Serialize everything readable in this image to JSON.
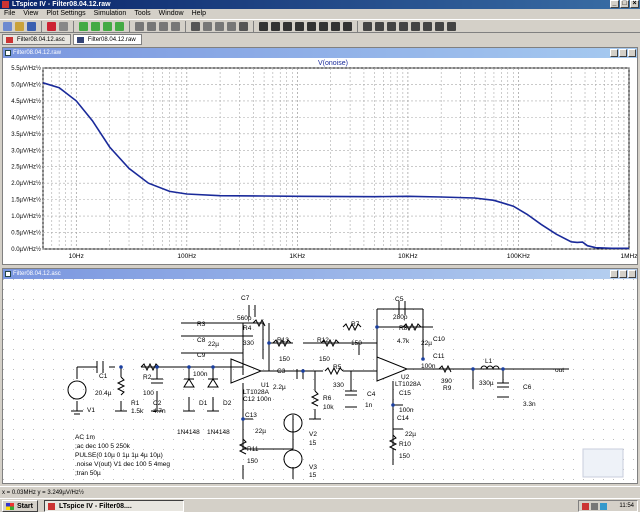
{
  "window": {
    "title": "LTspice IV - Filter08.04.12.raw"
  },
  "menu": [
    "File",
    "View",
    "Plot Settings",
    "Simulation",
    "Tools",
    "Window",
    "Help"
  ],
  "tabs": [
    {
      "label": "Filter08.04.12.asc",
      "active": false
    },
    {
      "label": "Filter08.04.12.raw",
      "active": true
    }
  ],
  "plot": {
    "window_title": "Filter08.04.12.raw",
    "trace_label": "V(onoise)",
    "trace_color": "#1a2a9a"
  },
  "chart_data": {
    "type": "line",
    "xscale": "log",
    "xlim": [
      5,
      1000000
    ],
    "ylim": [
      0,
      5.5
    ],
    "grid": true,
    "y_tick_labels": [
      "0.0µV/Hz½",
      "0.5µV/Hz½",
      "1.0µV/Hz½",
      "1.5µV/Hz½",
      "2.0µV/Hz½",
      "2.5µV/Hz½",
      "3.0µV/Hz½",
      "3.5µV/Hz½",
      "4.0µV/Hz½",
      "4.5µV/Hz½",
      "5.0µV/Hz½",
      "5.5µV/Hz½"
    ],
    "x_tick_labels": [
      {
        "f": 10,
        "label": "10Hz"
      },
      {
        "f": 100,
        "label": "100Hz"
      },
      {
        "f": 1000,
        "label": "1KHz"
      },
      {
        "f": 10000,
        "label": "10KHz"
      },
      {
        "f": 100000,
        "label": "100KHz"
      },
      {
        "f": 1000000,
        "label": "1MHz"
      }
    ],
    "series": [
      {
        "name": "V(onoise)",
        "x": [
          5,
          7,
          10,
          14,
          20,
          30,
          45,
          70,
          100,
          200,
          500,
          1000,
          5000,
          10000,
          20000,
          40000,
          60000,
          90000,
          120000,
          160000,
          220000,
          300000,
          340000,
          380000,
          420000,
          500000,
          700000,
          1000000
        ],
        "y": [
          5.05,
          4.9,
          4.5,
          3.9,
          3.1,
          2.45,
          2.0,
          1.75,
          1.67,
          1.62,
          1.61,
          1.6,
          1.59,
          1.6,
          1.58,
          1.55,
          1.48,
          1.3,
          1.05,
          0.75,
          0.45,
          0.22,
          0.2,
          0.21,
          0.1,
          0.04,
          0.02,
          0.02
        ]
      }
    ]
  },
  "schematic": {
    "window_title": "Filter08.04.12.asc",
    "labels": {
      "C7": "C7",
      "C7v": "560p",
      "R3": "R3",
      "R4": "R4",
      "R4v": "330",
      "C8": "C8",
      "C8v": "22µ",
      "C9": "C9",
      "C9v": "100n",
      "R13": "R13",
      "R13v": "150",
      "R12": "R12",
      "R12v": "150",
      "R7": "R7",
      "R7v": "150",
      "C5": "C5",
      "C5v": "280p",
      "R8": "R8",
      "R8v": "4.7k",
      "C10": "C10",
      "C10v": "22µ",
      "C11": "C11",
      "C11v": "100n",
      "C1": "C1",
      "C1v": "20.4µ",
      "R2": "R2",
      "R2v": "100",
      "R1": "R1",
      "R1v": "1.5k",
      "C2": "C2",
      "C2v": "4.7n",
      "D1": "D1",
      "D2": "D2",
      "D1v": "1N4148",
      "D2v": "1N4148",
      "V1": "V1",
      "U1": "U1",
      "U1v": "LT1028A",
      "C12": "C12 100n",
      "C13": "C13",
      "C13v": "22µ",
      "C3": "C3",
      "C3v": "2.2µ",
      "R5": "R5",
      "R5v": "330",
      "R6": "R6",
      "R6v": "10k",
      "C4": "C4",
      "C4v": "1n",
      "U2": "U2",
      "U2v": "LT1028A",
      "C15": "C15",
      "C15v": "100n",
      "C14": "C14",
      "C14v": "22µ",
      "R9": "R9",
      "R9v": "390",
      "L1": "L1",
      "L1v": "330µ",
      "C6": "C6",
      "C6v": "3.3n",
      "out": "out",
      "R11": "R11",
      "R11v": "150",
      "R10": "R10",
      "R10v": "150",
      "V2": "V2",
      "V2v": "15",
      "V3": "V3",
      "V3v": "15"
    },
    "directives": [
      "AC 1m",
      ";ac dec 100 5 250k",
      "PULSE(0 10µ 0 1µ 1µ 4µ 10µ)",
      ".noise V(out) V1 dec 100 5 4meg",
      ";tran 50µ"
    ]
  },
  "status": {
    "text": "x = 0.03MHz   y = 3.249µV/Hz½"
  },
  "taskbar": {
    "start": "Start",
    "task": "LTspice IV - Filter08....",
    "clock": "11:54"
  }
}
